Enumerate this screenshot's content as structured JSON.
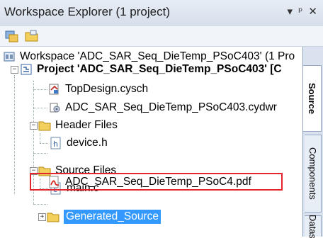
{
  "window": {
    "title": "Workspace Explorer (1 project)",
    "controls": [
      "▾",
      "ᵖ",
      "✕"
    ]
  },
  "toolbar": {
    "icons": [
      "workspace-settings-icon",
      "open-folder-icon"
    ]
  },
  "tree": {
    "workspace": "Workspace 'ADC_SAR_Seq_DieTemp_PSoC403' (1 Pro",
    "project": "Project  'ADC_SAR_Seq_DieTemp_PSoC403'  [C",
    "items": {
      "topdesign": "TopDesign.cysch",
      "cydwr": "ADC_SAR_Seq_DieTemp_PSoC403.cydwr",
      "header_files": "Header Files",
      "device_h": "device.h",
      "source_files": "Source Files",
      "main_c": "main.c",
      "pdf": "ADC_SAR_Seq_DieTemp_PSoC4.pdf",
      "generated": "Generated_Source"
    }
  },
  "tabs": {
    "source": "Source",
    "components": "Components",
    "datasheets": "Datas"
  }
}
